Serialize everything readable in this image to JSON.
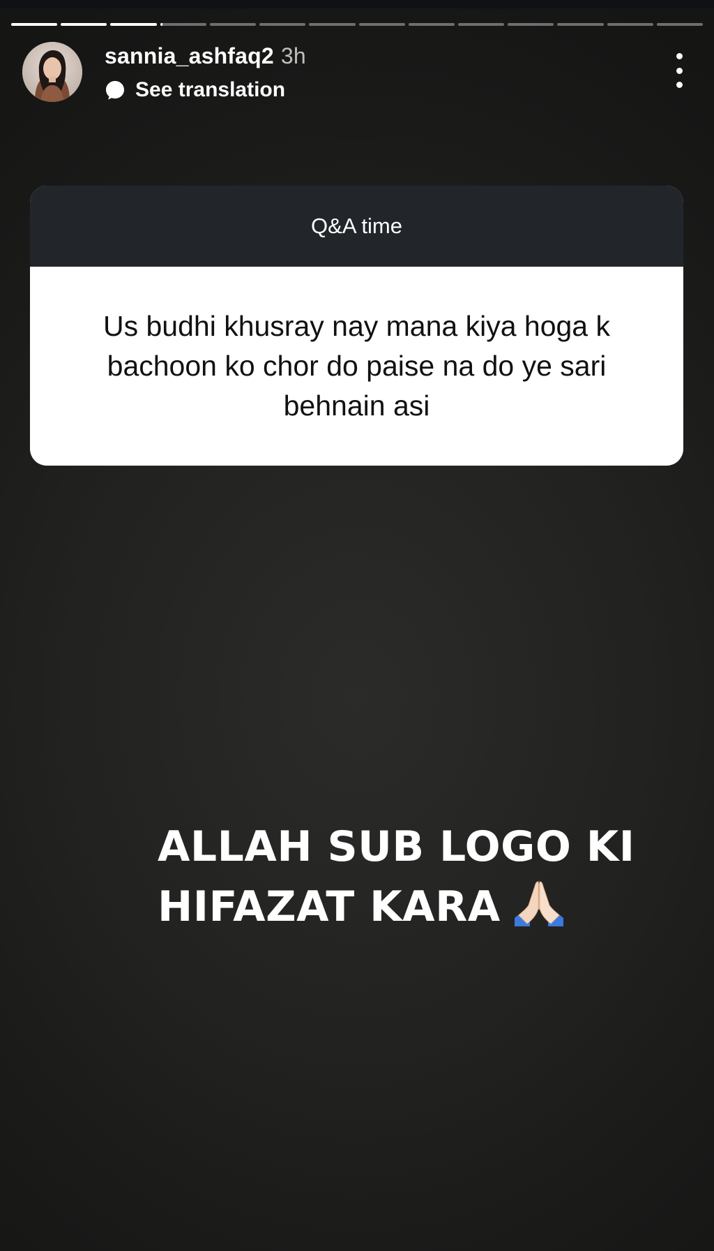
{
  "story": {
    "segments_total": 14,
    "segments_completed": 3,
    "current_segment_progress": 0.05,
    "colors": {
      "background": "#1e1e1d",
      "progress_active": "#ffffff",
      "card_header": "#22262b",
      "card_body": "#ffffff"
    }
  },
  "header": {
    "username": "sannia_ashfaq2",
    "timestamp": "3h",
    "translation_label": "See translation",
    "avatar_icon": "profile-photo",
    "translation_icon": "speech-bubble-icon",
    "menu_icon": "more-vertical-icon"
  },
  "qa_card": {
    "title": "Q&A time",
    "question": "Us budhi khusray nay mana kiya hoga k bachoon ko chor do paise na do ye sari behnain asi"
  },
  "caption": {
    "line1": "ALLAH SUB LOGO KI",
    "line2": "HIFAZAT KARA",
    "emoji": "folded-hands-icon"
  }
}
